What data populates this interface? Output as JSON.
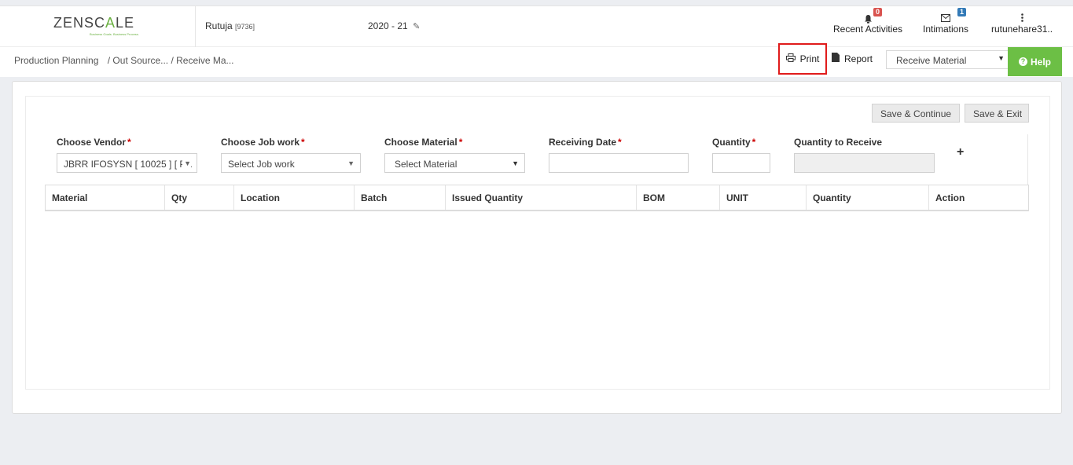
{
  "header": {
    "logo_text_a": "ZENSC",
    "logo_text_b": "A",
    "logo_text_c": "LE",
    "logo_tagline": "Business Goals. Business Process.",
    "user_name": "Rutuja",
    "user_id": "[9736]",
    "financial_year": "2020 - 21",
    "recent_activities_label": "Recent Activities",
    "recent_activities_count": "0",
    "intimations_label": "Intimations",
    "intimations_count": "1",
    "account_name": "rutunehare31.."
  },
  "breadcrumb": {
    "root": "Production Planning",
    "trail": "/ Out Source... / Receive Ma..."
  },
  "toolbar": {
    "print_label": "Print",
    "report_label": "Report",
    "page_select_value": "Receive Material",
    "help_label": "Help"
  },
  "form": {
    "save_continue_label": "Save & Continue",
    "save_exit_label": "Save & Exit",
    "vendor_label": "Choose Vendor",
    "vendor_value": "JBRR IFOSYSN [ 10025 ] [ P...",
    "jobwork_label": "Choose Job work",
    "jobwork_value": "Select Job work",
    "material_label": "Choose Material",
    "material_value": "Select Material",
    "receiving_date_label": "Receiving Date",
    "receiving_date_value": "",
    "quantity_label": "Quantity",
    "quantity_value": "",
    "qty_to_receive_label": "Quantity to Receive",
    "qty_to_receive_value": "",
    "required_mark": "*",
    "add_symbol": "+"
  },
  "table": {
    "columns": [
      "Material",
      "Qty",
      "Location",
      "Batch",
      "Issued Quantity",
      "BOM",
      "UNIT",
      "Quantity",
      "Action"
    ]
  },
  "colors": {
    "accent_green": "#6cbf45",
    "highlight_red": "#e01b1b",
    "badge_red": "#d9534f",
    "badge_blue": "#337ab7"
  },
  "icons": {
    "notifications": "bell-icon",
    "intimations": "envelope-icon",
    "account_menu": "vertical-dots-icon",
    "year_edit": "edit-icon",
    "print": "printer-icon",
    "report": "file-icon",
    "help": "question-circle-icon",
    "add_row": "plus-icon"
  }
}
